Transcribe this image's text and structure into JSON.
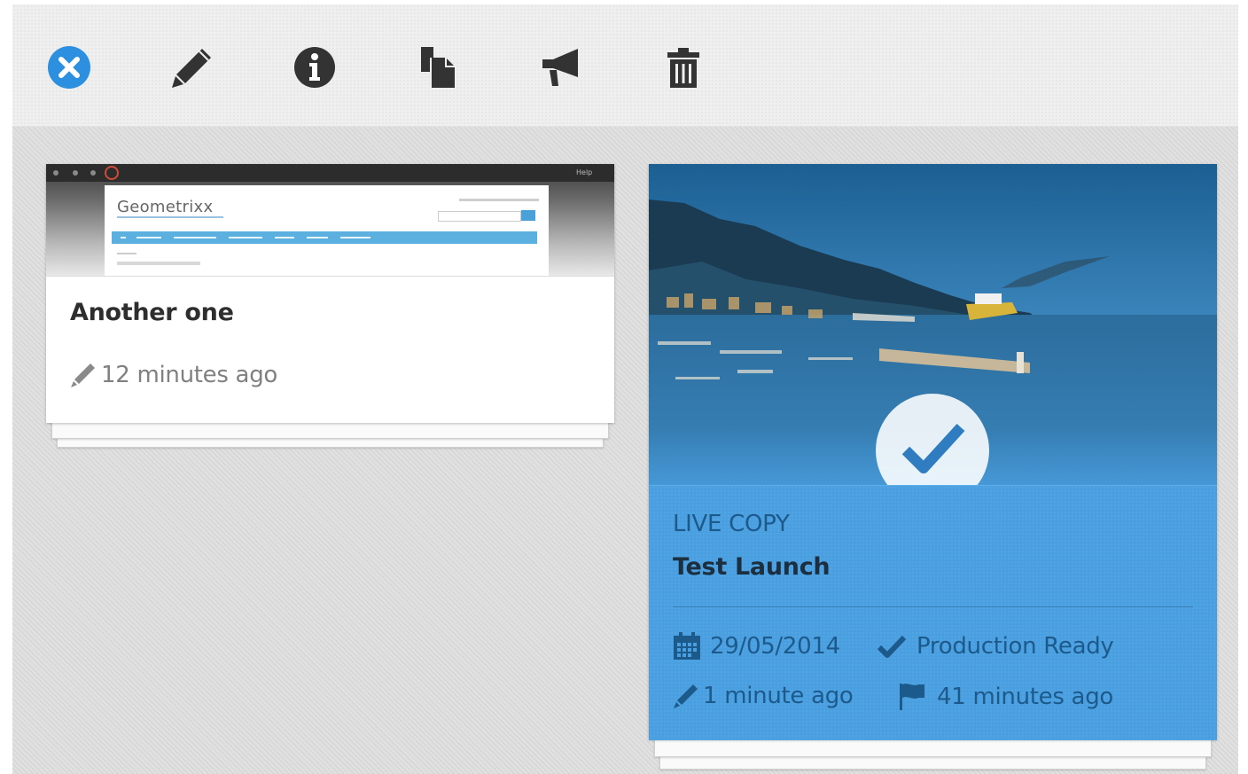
{
  "toolbar": {
    "icons": [
      "close-circle-icon",
      "pencil-icon",
      "info-icon",
      "copy-icon",
      "megaphone-icon",
      "trash-icon"
    ],
    "accent": "#2d8fe0"
  },
  "cards": [
    {
      "thumbnail": {
        "logo_text": "Geometrixx"
      },
      "title": "Another one",
      "modified": "12 minutes ago",
      "selected": false
    },
    {
      "label": "LIVE COPY",
      "title": "Test Launch",
      "date": "29/05/2014",
      "status": "Production Ready",
      "modified": "1 minute ago",
      "flagged": "41 minutes ago",
      "selected": true,
      "accent": "#4a9fe0"
    }
  ]
}
